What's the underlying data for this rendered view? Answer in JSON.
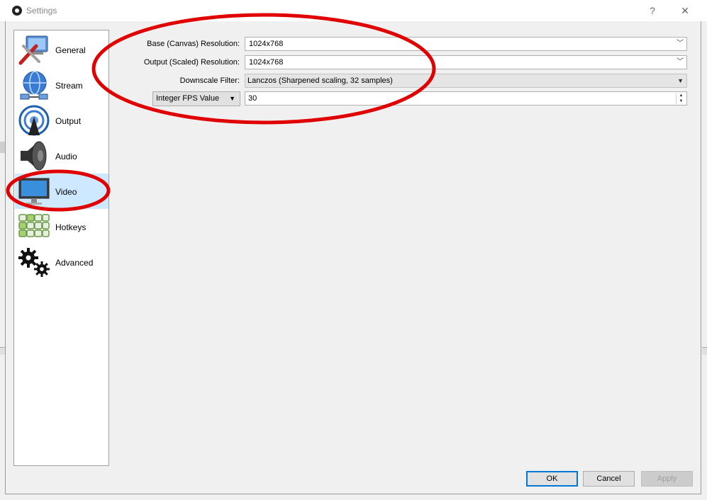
{
  "window": {
    "title": "Settings",
    "help_glyph": "?",
    "close_glyph": "✕"
  },
  "sidebar": {
    "items": [
      {
        "label": "General",
        "icon": "general-icon"
      },
      {
        "label": "Stream",
        "icon": "stream-icon"
      },
      {
        "label": "Output",
        "icon": "output-icon"
      },
      {
        "label": "Audio",
        "icon": "audio-icon"
      },
      {
        "label": "Video",
        "icon": "video-icon",
        "selected": true
      },
      {
        "label": "Hotkeys",
        "icon": "hotkeys-icon"
      },
      {
        "label": "Advanced",
        "icon": "advanced-icon"
      }
    ]
  },
  "video": {
    "base_label": "Base (Canvas) Resolution:",
    "base_value": "1024x768",
    "output_label": "Output (Scaled) Resolution:",
    "output_value": "1024x768",
    "filter_label": "Downscale Filter:",
    "filter_value": "Lanczos (Sharpened scaling, 32 samples)",
    "fps_type": "Integer FPS Value",
    "fps_value": "30"
  },
  "buttons": {
    "ok": "OK",
    "cancel": "Cancel",
    "apply": "Apply"
  },
  "colors": {
    "selection": "#cde8ff",
    "annotation": "#e00000",
    "default_button_border": "#0078d7"
  }
}
